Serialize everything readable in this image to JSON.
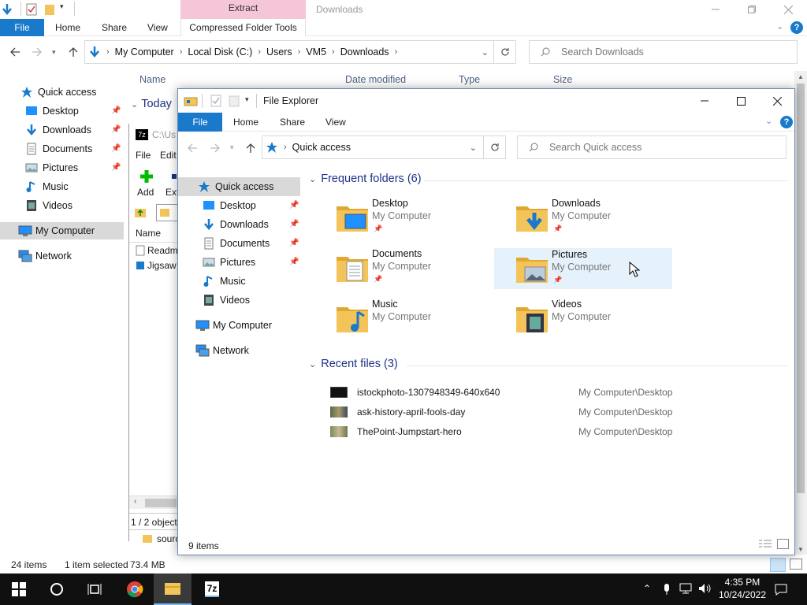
{
  "bg": {
    "context_tab": "Extract",
    "context_subtab": "Compressed Folder Tools",
    "window_title": "Downloads",
    "ribbon": {
      "file": "File",
      "home": "Home",
      "share": "Share",
      "view": "View"
    },
    "address": [
      "My Computer",
      "Local Disk (C:)",
      "Users",
      "VM5",
      "Downloads"
    ],
    "search_placeholder": "Search Downloads",
    "nav": {
      "quick_access": "Quick access",
      "items": [
        "Desktop",
        "Downloads",
        "Documents",
        "Pictures",
        "Music",
        "Videos"
      ],
      "my_computer": "My Computer",
      "network": "Network"
    },
    "columns": {
      "name": "Name",
      "date": "Date modified",
      "type": "Type",
      "size": "Size"
    },
    "group_today": "Today",
    "status_items": "24 items",
    "status_selected": "1 item selected",
    "status_size": "73.4 MB",
    "below_item": "sourc"
  },
  "zip": {
    "path": "C:\\Us",
    "menu_file": "File",
    "menu_edit": "Edit",
    "add": "Add",
    "ext": "Ext",
    "col_name": "Name",
    "rows": [
      "Readm",
      "Jigsaw"
    ],
    "status": "1 / 2 object"
  },
  "fg": {
    "title": "File Explorer",
    "ribbon": {
      "file": "File",
      "home": "Home",
      "share": "Share",
      "view": "View"
    },
    "address": "Quick access",
    "search_placeholder": "Search Quick access",
    "nav": {
      "quick_access": "Quick access",
      "items": [
        "Desktop",
        "Downloads",
        "Documents",
        "Pictures",
        "Music",
        "Videos"
      ],
      "my_computer": "My Computer",
      "network": "Network"
    },
    "frequent_title": "Frequent folders (6)",
    "folders": [
      {
        "name": "Desktop",
        "location": "My Computer",
        "pinned": true
      },
      {
        "name": "Downloads",
        "location": "My Computer",
        "pinned": true
      },
      {
        "name": "Documents",
        "location": "My Computer",
        "pinned": true
      },
      {
        "name": "Pictures",
        "location": "My Computer",
        "pinned": true
      },
      {
        "name": "Music",
        "location": "My Computer",
        "pinned": false
      },
      {
        "name": "Videos",
        "location": "My Computer",
        "pinned": false
      }
    ],
    "recent_title": "Recent files (3)",
    "recent": [
      {
        "name": "istockphoto-1307948349-640x640",
        "path": "My Computer\\Desktop"
      },
      {
        "name": "ask-history-april-fools-day",
        "path": "My Computer\\Desktop"
      },
      {
        "name": "ThePoint-Jumpstart-hero",
        "path": "My Computer\\Desktop"
      }
    ],
    "status_items": "9 items"
  },
  "taskbar": {
    "time": "4:35 PM",
    "date": "10/24/2022"
  },
  "colors": {
    "accent": "#1979ca",
    "folder": "#f3c45a",
    "context_tab": "#f5c5d8",
    "section": "#1e3287"
  }
}
